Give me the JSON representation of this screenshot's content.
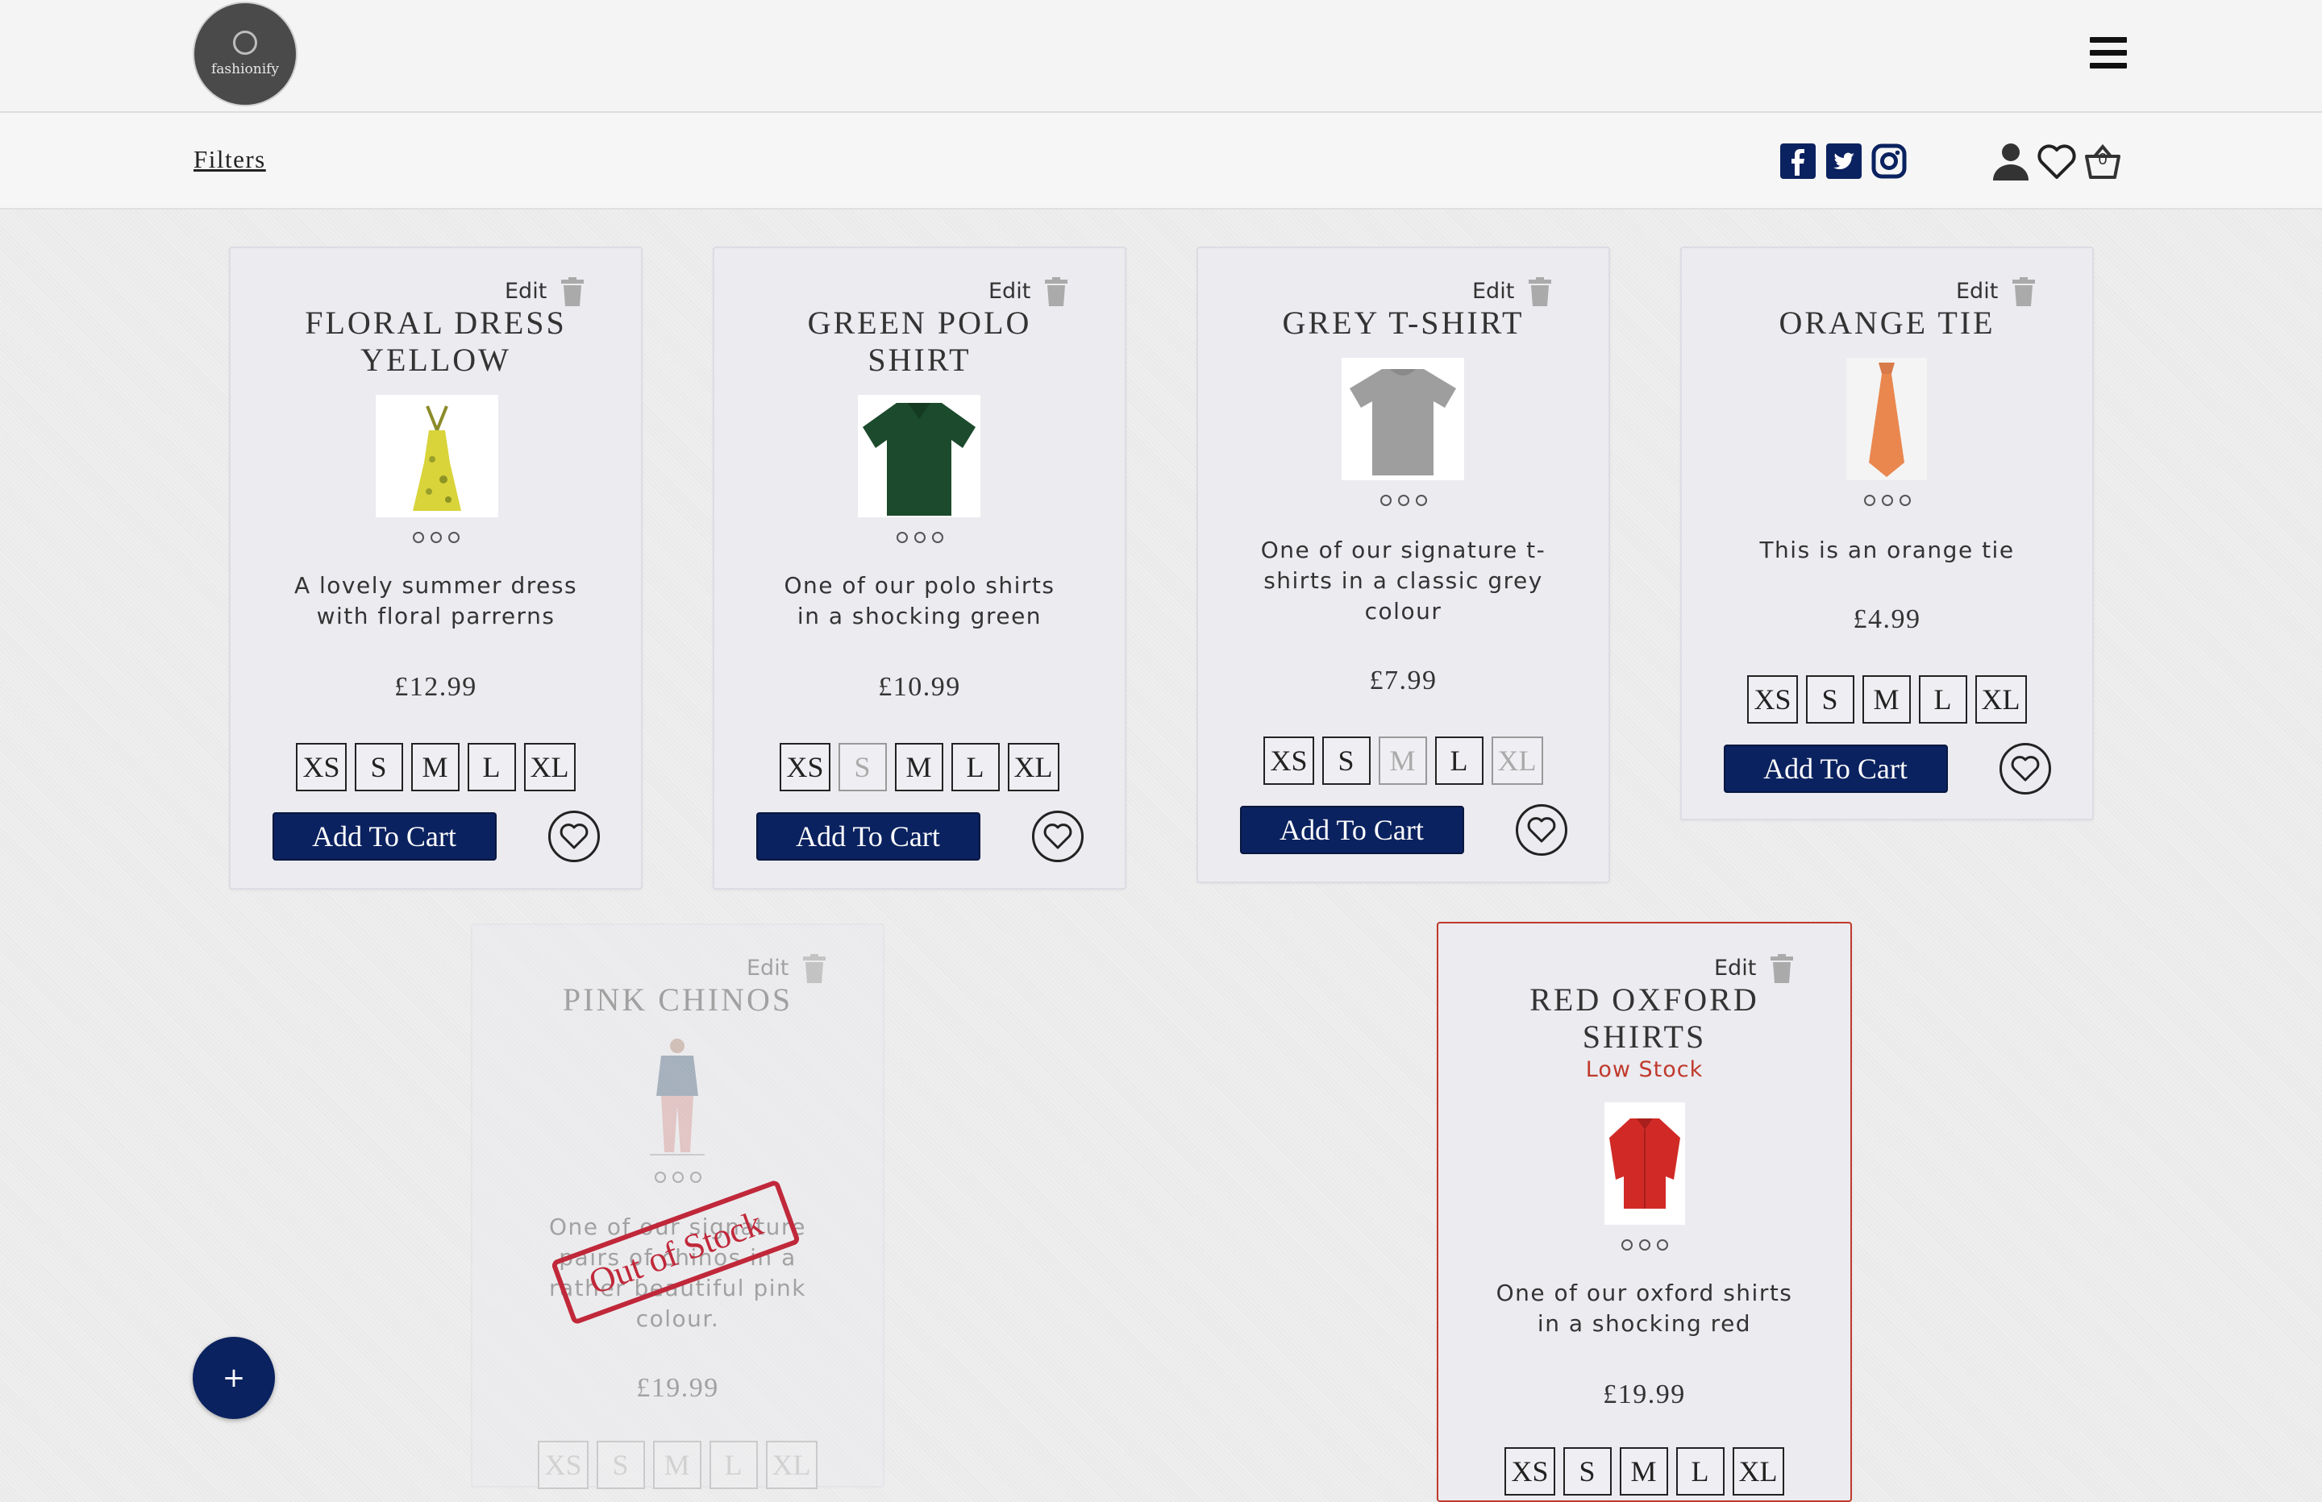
{
  "header": {
    "logo_text": "fashionify",
    "filters_label": "Filters",
    "cart_count": "0"
  },
  "icons": {
    "menu": "hamburger-icon",
    "social": [
      "facebook-icon",
      "twitter-icon",
      "instagram-icon"
    ],
    "user": "user-icon",
    "wishlist": "heart-icon",
    "cart": "basket-icon",
    "trash": "trash-icon"
  },
  "colors": {
    "primary": "#0b2260",
    "alert": "#c0392b",
    "card_bg": "#ebebf0"
  },
  "common": {
    "edit_label": "Edit",
    "add_to_cart": "Add To Cart",
    "sizes": [
      "XS",
      "S",
      "M",
      "L",
      "XL"
    ],
    "out_of_stock": "Out of Stock",
    "fab_label": "+"
  },
  "products": [
    {
      "title_lines": [
        "FLORAL DRESS",
        "YELLOW"
      ],
      "desc_lines": [
        "A lovely summer dress",
        "with floral parrerns"
      ],
      "price": "£12.99",
      "disabled_sizes": []
    },
    {
      "title_lines": [
        "GREEN POLO",
        "SHIRT"
      ],
      "desc_lines": [
        "One of our polo shirts",
        "in a shocking green"
      ],
      "price": "£10.99",
      "disabled_sizes": [
        "S"
      ]
    },
    {
      "title_lines": [
        "GREY T-SHIRT"
      ],
      "desc_lines": [
        "One of our signature t-",
        "shirts in a classic grey",
        "colour"
      ],
      "price": "£7.99",
      "disabled_sizes": [
        "M",
        "XL"
      ]
    },
    {
      "title_lines": [
        "ORANGE TIE"
      ],
      "desc_lines": [
        "This is an orange tie"
      ],
      "price": "£4.99",
      "disabled_sizes": []
    },
    {
      "title_lines": [
        "PINK CHINOS"
      ],
      "desc_lines": [
        "One of our signature",
        "pairs of chinos in a",
        "rather beautiful pink",
        "colour."
      ],
      "price": "£19.99",
      "status": "out-of-stock"
    },
    {
      "title_lines": [
        "RED OXFORD",
        "SHIRTS"
      ],
      "stock_note": "Low Stock",
      "desc_lines": [
        "One of our oxford shirts",
        "in a shocking red"
      ],
      "price": "£19.99",
      "status": "low-stock"
    }
  ]
}
